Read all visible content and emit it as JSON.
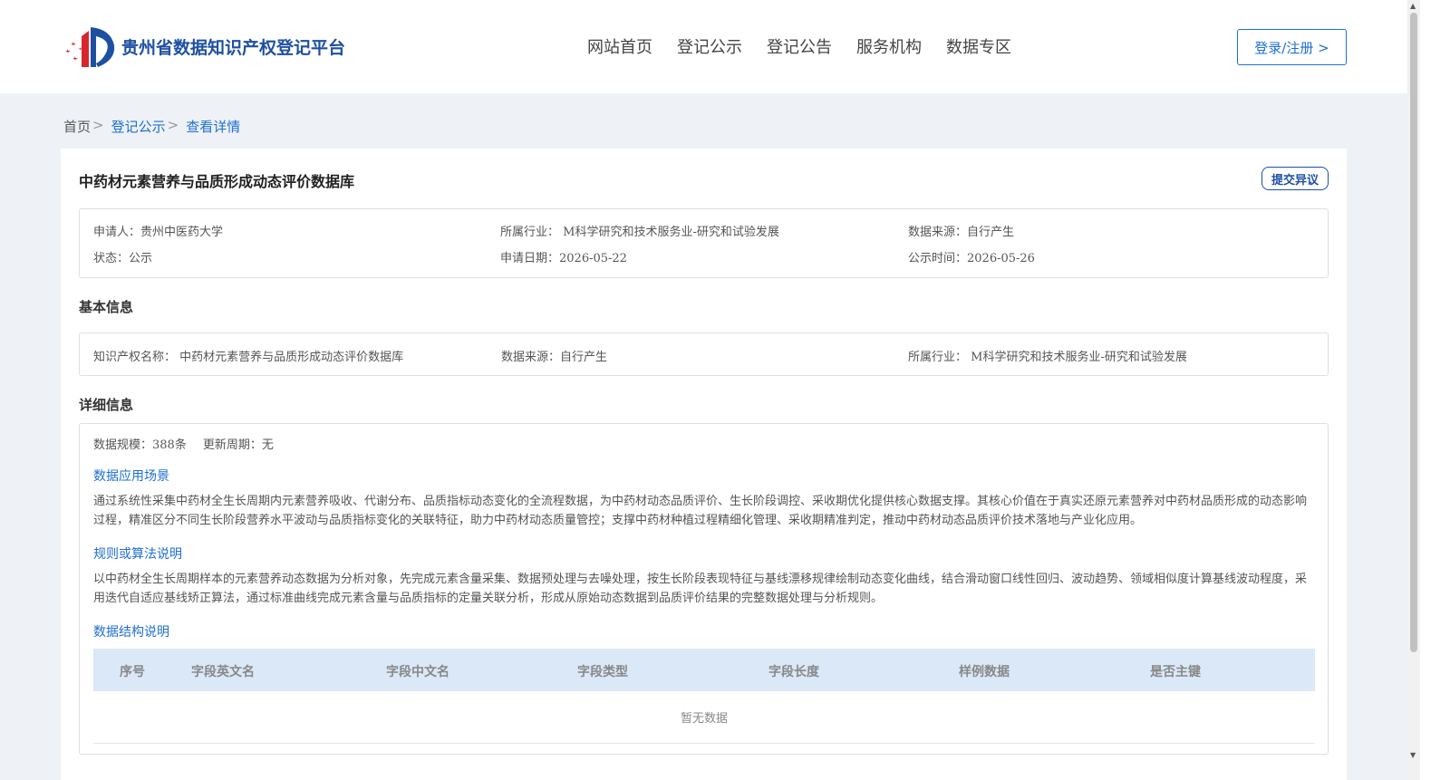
{
  "header": {
    "logo_text": "贵州省数据知识产权登记平台",
    "nav": [
      "网站首页",
      "登记公示",
      "登记公告",
      "服务机构",
      "数据专区"
    ],
    "login_label": "登录/注册 >"
  },
  "breadcrumb": {
    "home": "首页",
    "sep": ">",
    "level1": "登记公示",
    "level2": "查看详情"
  },
  "detail": {
    "title": "中药材元素营养与品质形成动态评价数据库",
    "objection_label": "提交异议",
    "summary": {
      "applicant": "申请人：贵州中医药大学",
      "industry": "所属行业： M科学研究和技术服务业-研究和试验发展",
      "source": "数据来源：自行产生",
      "status": "状态：公示",
      "apply_date": "申请日期：2026-05-22",
      "publish_date": "公示时间：2026-05-26"
    },
    "basic_title": "基本信息",
    "basic": {
      "name": "知识产权名称： 中药材元素营养与品质形成动态评价数据库",
      "source": "数据来源：自行产生",
      "industry": "所属行业： M科学研究和技术服务业-研究和试验发展"
    },
    "detail_title": "详细信息",
    "scale": "数据规模：388条",
    "update_cycle": "更新周期：无",
    "scene_title": "数据应用场景",
    "scene_text": "通过系统性采集中药材全生长周期内元素营养吸收、代谢分布、品质指标动态变化的全流程数据，为中药材动态品质评价、生长阶段调控、采收期优化提供核心数据支撑。其核心价值在于真实还原元素营养对中药材品质形成的动态影响过程，精准区分不同生长阶段营养水平波动与品质指标变化的关联特征，助力中药材动态质量管控；支撑中药材种植过程精细化管理、采收期精准判定，推动中药材动态品质评价技术落地与产业化应用。",
    "rule_title": "规则或算法说明",
    "rule_text": "以中药材全生长周期样本的元素营养动态数据为分析对象，先完成元素含量采集、数据预处理与去噪处理，按生长阶段表现特征与基线漂移规律绘制动态变化曲线，结合滑动窗口线性回归、波动趋势、领域相似度计算基线波动程度，采用迭代自适应基线矫正算法，通过标准曲线完成元素含量与品质指标的定量关联分析，形成从原始动态数据到品质评价结果的完整数据处理与分析规则。",
    "structure_title": "数据结构说明",
    "table_headers": [
      "序号",
      "字段英文名",
      "字段中文名",
      "字段类型",
      "字段长度",
      "样例数据",
      "是否主键"
    ],
    "table_empty": "暂无数据"
  },
  "colors": {
    "brand": "#1e50a2",
    "link": "#1e6fd0",
    "table_header_bg": "#dbe8f7",
    "page_bg": "#eef2f6"
  }
}
